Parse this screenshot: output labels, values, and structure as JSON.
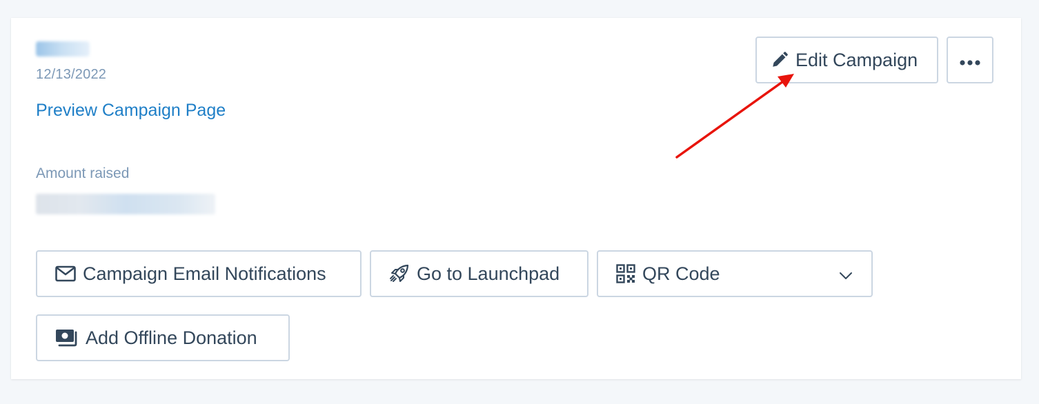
{
  "campaign": {
    "date": "12/13/2022",
    "preview_link": "Preview Campaign Page",
    "amount_label": "Amount raised"
  },
  "header_actions": {
    "edit_label": "Edit Campaign",
    "more_icon": "ellipsis-icon"
  },
  "actions": {
    "email_notifications": "Campaign Email Notifications",
    "launchpad": "Go to Launchpad",
    "qr_code": "QR Code",
    "offline_donation": "Add Offline Donation"
  },
  "colors": {
    "link": "#1f7fc7",
    "muted_text": "#7c98b6",
    "button_text": "#33475b",
    "button_border": "#cbd6e2",
    "annotation_arrow": "#e8140c"
  }
}
